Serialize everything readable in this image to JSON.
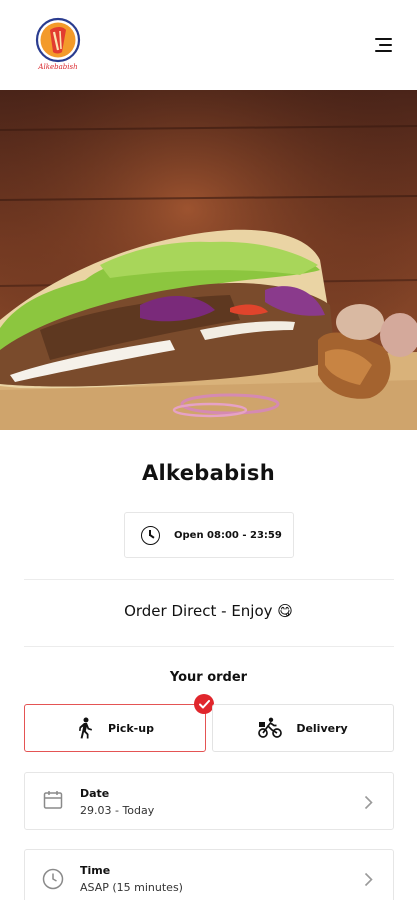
{
  "header": {
    "logo_text": "Alkebabish",
    "logo_icon": "kebab-logo",
    "menu_icon": "hamburger-menu-icon"
  },
  "hero": {
    "image_description_icon": "doner-kebab-photo"
  },
  "restaurant": {
    "name": "Alkebabish",
    "hours": "Open 08:00 - 23:59",
    "tagline": "Order Direct - Enjoy 😋"
  },
  "order": {
    "heading": "Your order",
    "options": [
      {
        "label": "Pick-up",
        "icon": "walking-person-icon",
        "selected": true
      },
      {
        "label": "Delivery",
        "icon": "bicycle-delivery-icon",
        "selected": false
      }
    ],
    "date": {
      "label": "Date",
      "value": "29.03 - Today",
      "icon": "calendar-icon"
    },
    "time": {
      "label": "Time",
      "value": "ASAP (15 minutes)",
      "icon": "clock-icon"
    }
  },
  "colors": {
    "accent": "#e0262c",
    "border": "#e6e6e6",
    "text": "#111111"
  }
}
